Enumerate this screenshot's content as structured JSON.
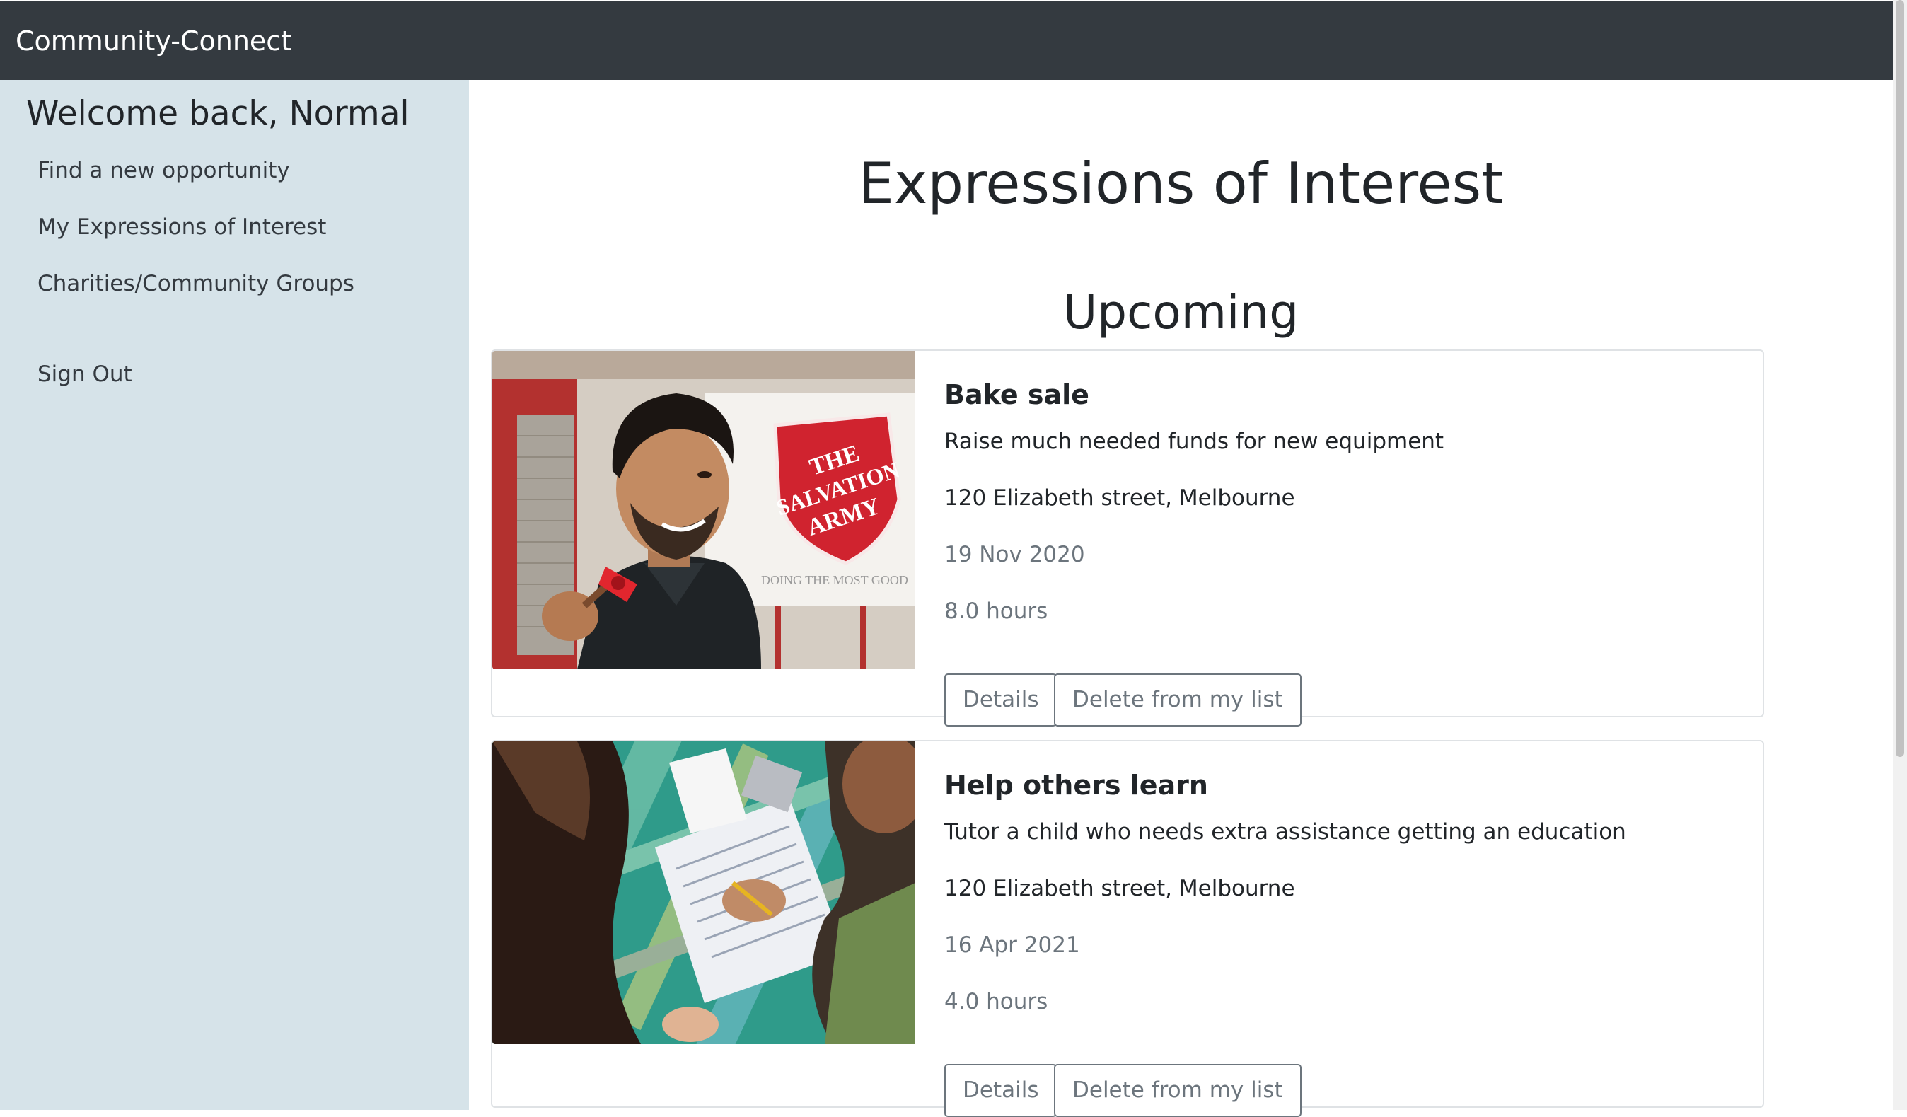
{
  "app": {
    "brand": "Community-Connect"
  },
  "sidebar": {
    "welcome": "Welcome back, Normal",
    "items": [
      {
        "label": "Find a new opportunity"
      },
      {
        "label": "My Expressions of Interest"
      },
      {
        "label": "Charities/Community Groups"
      }
    ],
    "sign_out": "Sign Out"
  },
  "main": {
    "title": "Expressions of Interest",
    "section": "Upcoming",
    "details_label": "Details",
    "delete_label": "Delete from my list",
    "cards": [
      {
        "title": "Bake sale",
        "description": "Raise much needed funds for new equipment",
        "address": "120 Elizabeth street, Melbourne",
        "date": "19 Nov 2020",
        "hours": "8.0 hours",
        "image_text": {
          "line1": "THE",
          "line2": "SALVATION",
          "line3": "ARMY",
          "banner": "DOING THE MOST GOOD"
        }
      },
      {
        "title": "Help others learn",
        "description": "Tutor a child who needs extra assistance getting an education",
        "address": "120 Elizabeth street, Melbourne",
        "date": "16 Apr 2021",
        "hours": "4.0 hours"
      }
    ]
  },
  "colors": {
    "topbar": "#343a40",
    "sidebar": "#d6e3e9",
    "salvation_red": "#d0232f",
    "button_outline": "#6c757d",
    "muted_text": "#6c757d"
  }
}
